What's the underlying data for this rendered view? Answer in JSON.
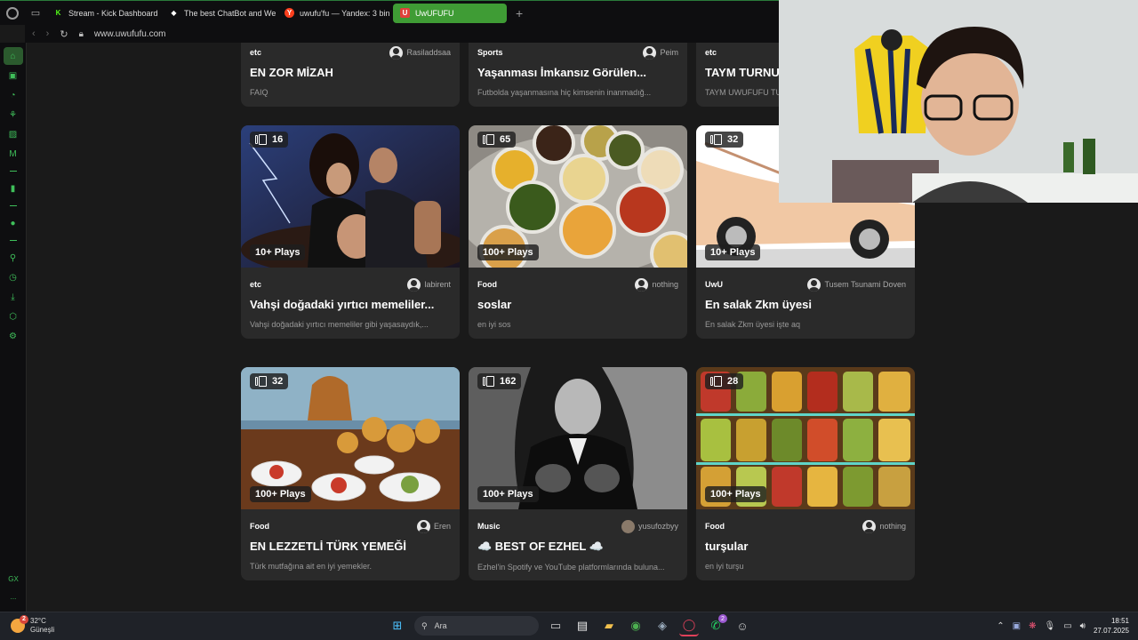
{
  "browser": {
    "tabs": [
      {
        "label": "Stream - Kick Dashboard",
        "favicon": "K",
        "favicon_color": "#53fc18",
        "active": false
      },
      {
        "label": "The best ChatBot and Web",
        "favicon": "◆",
        "favicon_color": "#ffffff",
        "active": false
      },
      {
        "label": "uwufu'fu — Yandex: 3 bin",
        "favicon": "Y",
        "favicon_color": "#fc3f1d",
        "active": false
      },
      {
        "label": "UwUFUFU",
        "favicon": "U",
        "favicon_color": "#e0413a",
        "active": true
      }
    ],
    "new_tab_icon": "+",
    "url": "www.uwufufu.com",
    "accent_color": "#3f9c35"
  },
  "sidebar": {
    "bottom_label": "GX",
    "more_label": "..."
  },
  "cards": [
    {
      "category": "etc",
      "author": "Rasiladdsaa",
      "title": "EN ZOR MİZAH",
      "desc": "FAIQ"
    },
    {
      "category": "Sports",
      "author": "Peim",
      "title": "Yaşanması İmkansız Görülen...",
      "desc": "Futbolda yaşanmasına hiç kimsenin inanmadığ..."
    },
    {
      "category": "etc",
      "author": "",
      "title": "TAYM TURNUVASI",
      "desc": "TAYM UWUFUFU TURNUVASI"
    },
    {
      "count": "16",
      "plays": "10+ Plays",
      "category": "etc",
      "author": "labirent",
      "title": "Vahşi doğadaki yırtıcı memeliler...",
      "desc": "Vahşi doğadaki yırtıcı memeliler gibi yaşasaydık,..."
    },
    {
      "count": "65",
      "plays": "100+ Plays",
      "category": "Food",
      "author": "nothing",
      "title": "soslar",
      "desc": "en iyi sos"
    },
    {
      "count": "32",
      "plays": "10+ Plays",
      "category": "UwU",
      "author": "Tusem Tsunami Doven",
      "title": "En salak Zkm üyesi",
      "desc": "En salak Zkm üyesi işte aq"
    },
    {
      "count": "32",
      "plays": "100+ Plays",
      "category": "Food",
      "author": "Eren",
      "title": "EN LEZZETLİ TÜRK YEMEĞİ",
      "desc": "Türk mutfağına ait en iyi yemekler."
    },
    {
      "count": "162",
      "plays": "100+ Plays",
      "category": "Music",
      "author": "yusufozbyy",
      "title": "☁️ BEST OF EZHEL ☁️",
      "desc": "Ezhel'in Spotify ve YouTube platformlarında buluna..."
    },
    {
      "count": "28",
      "plays": "100+ Plays",
      "category": "Food",
      "author": "nothing",
      "title": "turşular",
      "desc": "en iyi turşu"
    }
  ],
  "taskbar": {
    "weather_temp": "32°C",
    "weather_desc": "Güneşli",
    "weather_badge": "2",
    "search_placeholder": "Ara",
    "whatsapp_badge": "2",
    "time": "18:51",
    "date": "27.07.2025"
  }
}
